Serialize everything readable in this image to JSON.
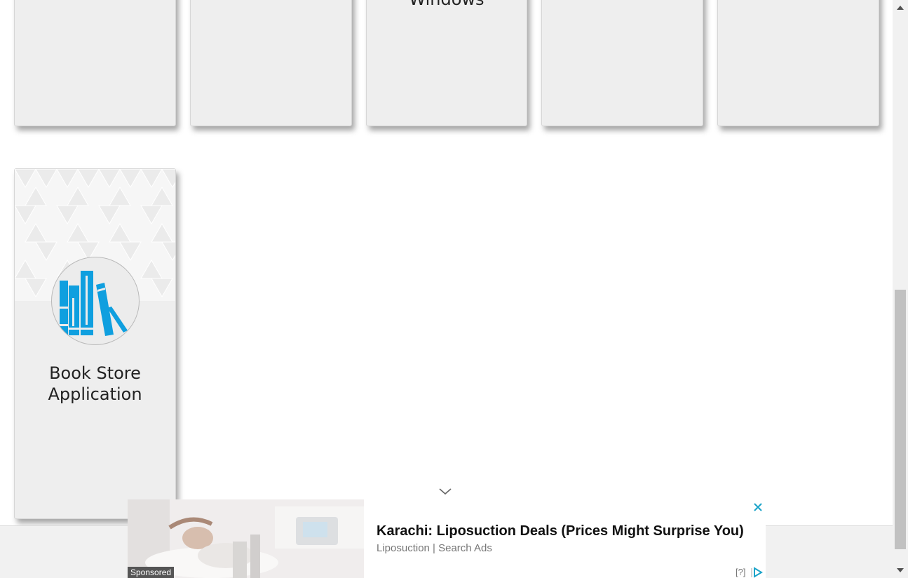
{
  "cards_row1": [
    {
      "title": ""
    },
    {
      "title": ""
    },
    {
      "title": "Windows"
    },
    {
      "title": ""
    },
    {
      "title": ""
    }
  ],
  "book_card": {
    "title_line1": "Book Store",
    "title_line2": "Application",
    "icon": "bookshelf-icon",
    "icon_color": "#0f9fdf"
  },
  "ad": {
    "title": "Karachi: Liposuction Deals (Prices Might Surprise You)",
    "subtitle": "Liposuction | Search Ads",
    "sponsored_label": "Sponsored",
    "help_label": "[?]",
    "close_icon": "close-icon",
    "accent": "#1aa3c9"
  },
  "colors": {
    "card_bg": "#eeeeee",
    "page_bg": "#ffffff",
    "scrollbar_thumb": "#c1c1c1"
  }
}
